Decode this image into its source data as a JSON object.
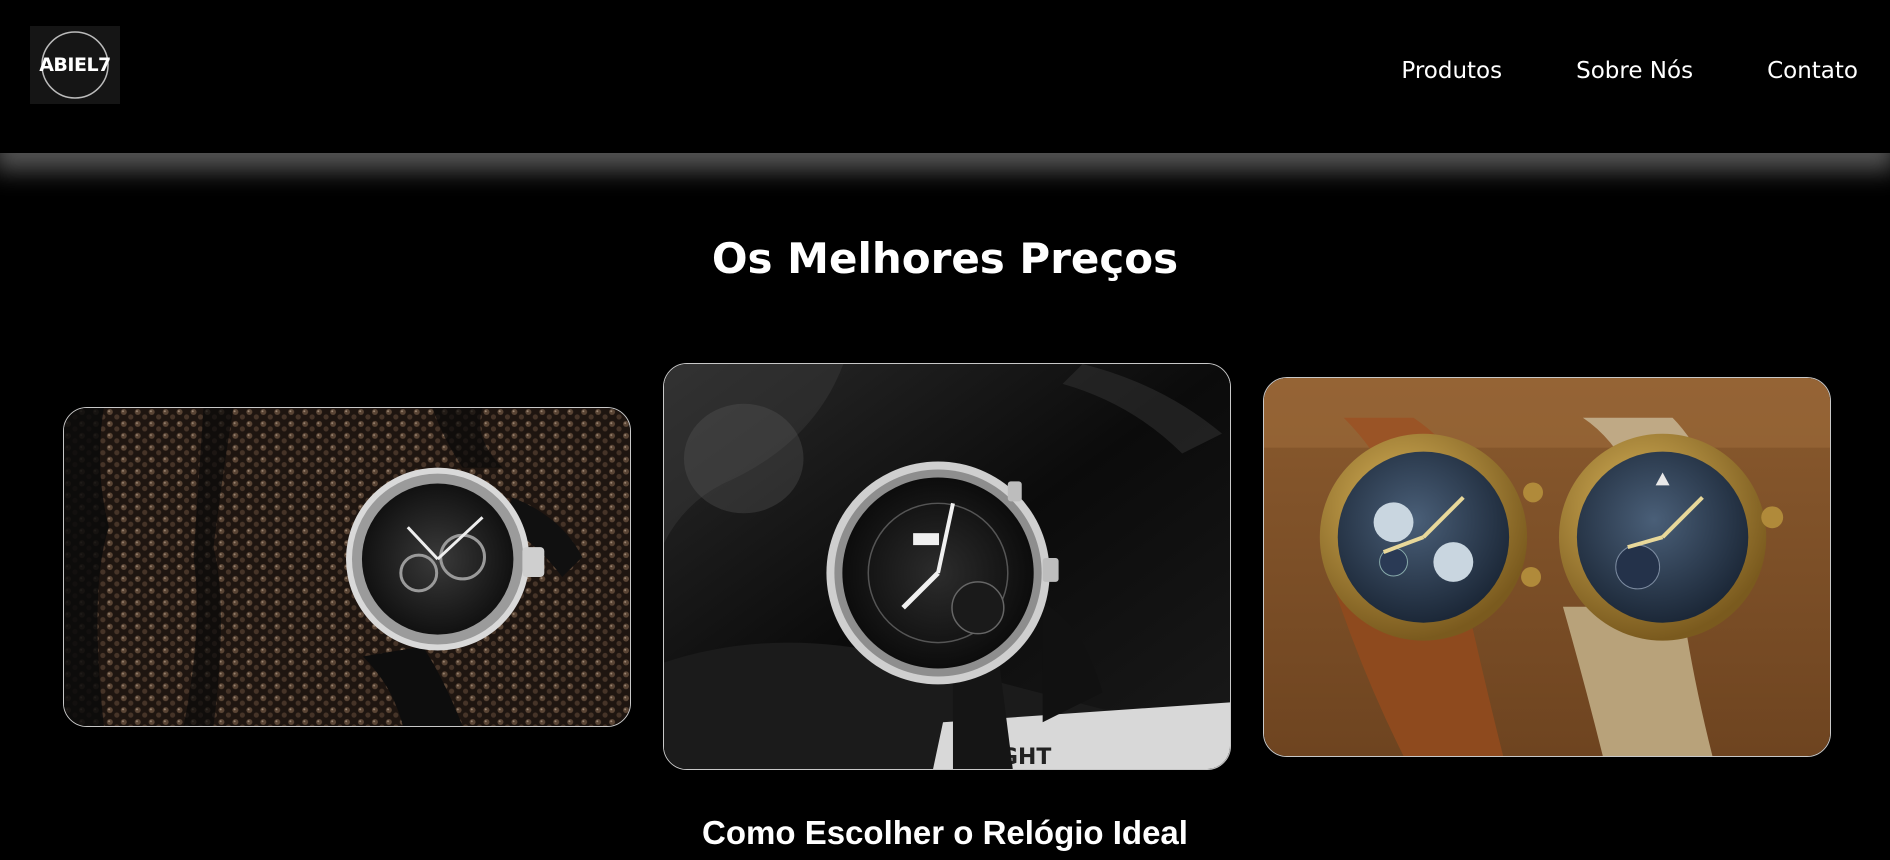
{
  "header": {
    "logo_text": "ABIEL7",
    "nav": [
      "Produtos",
      "Sobre Nós",
      "Contato"
    ]
  },
  "main": {
    "title": "Os Melhores Preços",
    "products": [
      {
        "image": "skeleton-watch-diamond-photo"
      },
      {
        "image": "pilot-worldtimer-watch-photo"
      },
      {
        "image": "bronze-pilot-watches-photo"
      }
    ],
    "section_title": "Como Escolher o Relógio Ideal"
  },
  "colors": {
    "background": "#000000",
    "text": "#ffffff",
    "card_border": "#c8c8c8"
  }
}
